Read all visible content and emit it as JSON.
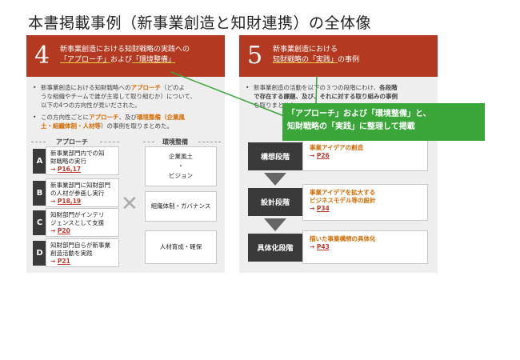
{
  "title": "本書掲載事例（新事業創造と知財連携）の全体像",
  "left_panel": {
    "number": "4",
    "header_line1": "新事業創造における知財戦略の実践への",
    "header_line2_a": "「アプローチ」",
    "header_line2_b": "および",
    "header_line2_c": "「環境整備」",
    "bullet1_line1_pre": "新事業創造における知財戦略への",
    "bullet1_line1_hl": "アプローチ",
    "bullet1_line1_post": "（どのよ",
    "bullet1_line2": "うな組織やチームで誰が主導して取り組むか）について、",
    "bullet1_line3": "以下の4つの方向性が見いだされた。",
    "bullet2_line1_pre": "この方向性ごとに",
    "bullet2_line1_hl1": "アプローチ",
    "bullet2_line1_mid": "、及び",
    "bullet2_line1_hl2": "環境整備",
    "bullet2_line1_post": "（企業風",
    "bullet2_line2_hl": "土・組織体制・人材等",
    "bullet2_line2_post": "）の事例を取りまとめた。",
    "approach_label": "アプローチ",
    "env_label": "環境整備",
    "approaches": [
      {
        "letter": "A",
        "line1": "新事業部門内での知",
        "line2": "財戦略の実行",
        "link": "P16,17"
      },
      {
        "letter": "B",
        "line1": "新事業部門に知財部門",
        "line2": "の人材が参画し実行",
        "link": "P18,19"
      },
      {
        "letter": "C",
        "line1": "知財部門がインテリ",
        "line2": "ジェンスとして支援",
        "link": "P20"
      },
      {
        "letter": "D",
        "line1": "知財部門自らが新事業",
        "line2": "創造活動を実践",
        "link": "P21"
      }
    ],
    "cross": "✕",
    "env_items": [
      {
        "line1": "企業風土",
        "line2": "・",
        "line3": "ビジョン"
      },
      {
        "line1": "組織体制・ガバナンス"
      },
      {
        "line1": "人材育成・確保"
      }
    ]
  },
  "right_panel": {
    "number": "5",
    "header_line1": "新事業創造における",
    "header_line2_a": "知財戦略の",
    "header_line2_b": "「実践」",
    "header_line2_c": "の事例",
    "bullet1_line1_pre": "新事業創造の活動を以下の３つの段階にわけ、",
    "bullet1_line1_hl": "各段階",
    "bullet1_line2": "で存在する課題、及び、それに対する取り組みの事例",
    "bullet1_line3": "を取りまとめた。",
    "stages": [
      {
        "name": "構想段階",
        "desc_line1": "事業アイデアの創造",
        "desc_line2": "",
        "link": "P26"
      },
      {
        "name": "設計段階",
        "desc_line1": "事業アイデアを拡大する",
        "desc_line2": "ビジネスモデル等の設計",
        "link": "P34"
      },
      {
        "name": "具体化段階",
        "desc_line1": "描いた事業構想の具体化",
        "desc_line2": "",
        "link": "P43"
      }
    ]
  },
  "callout": {
    "line1": "「アプローチ」および「環境整備」と、",
    "line2": "知財戦略の「実践」に整理して掲載"
  },
  "colors": {
    "header_red": "#b33a20",
    "accent_orange": "#d46a00",
    "callout_green": "#3aa63a",
    "dark_label": "#3a3a3a"
  }
}
